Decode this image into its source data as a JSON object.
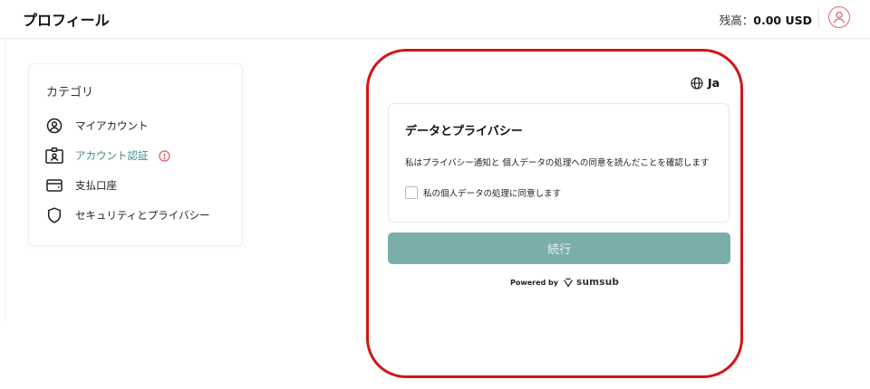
{
  "header": {
    "title": "プロフィール",
    "balance_label": "残高：",
    "balance_amount": "0.00 USD"
  },
  "sidebar": {
    "title": "カテゴリ",
    "items": [
      {
        "label": "マイアカウント",
        "icon": "user-circle-icon"
      },
      {
        "label": "アカウント認証",
        "icon": "id-card-icon",
        "active": true,
        "warning": true
      },
      {
        "label": "支払口座",
        "icon": "wallet-icon"
      },
      {
        "label": "セキュリティとプライバシー",
        "icon": "shield-icon"
      }
    ]
  },
  "verification": {
    "language": "Ja",
    "card_title": "データとプライバシー",
    "notice_text": "私はプライバシー通知と 個人データの処理への同意を読んだことを確認します",
    "consent_label": "私の個人データの処理に同意します",
    "consent_checked": false,
    "continue_label": "続行",
    "powered_by": "Powered by",
    "brand": "sumsub"
  },
  "colors": {
    "accent": "#3e8d85",
    "button_disabled": "#7aaeaa",
    "highlight_outline": "#d21515",
    "avatar_border": "#d86a72",
    "warning": "#e05a66"
  }
}
